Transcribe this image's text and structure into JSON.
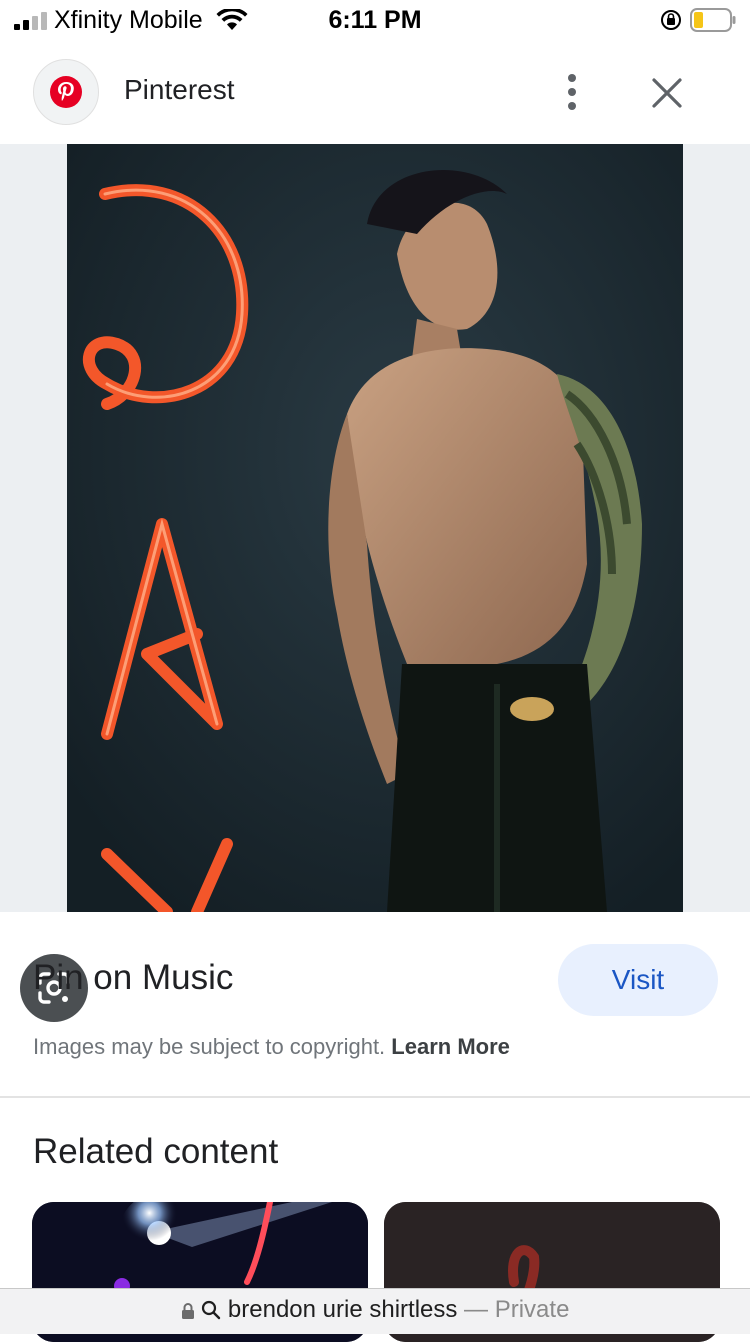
{
  "status_bar": {
    "carrier": "Xfinity Mobile",
    "time": "6:11 PM"
  },
  "header": {
    "source_name": "Pinterest",
    "logo_icon": "pinterest-logo-icon",
    "menu_icon": "more-vertical-icon",
    "close_icon": "close-icon"
  },
  "image": {
    "description_icon": "photo",
    "lens_icon": "google-lens-icon"
  },
  "info": {
    "title": "Pin on Music",
    "visit_label": "Visit",
    "copyright_text": "Images may be subject to copyright.",
    "learn_more_label": "Learn More"
  },
  "related": {
    "title": "Related content"
  },
  "url_bar": {
    "query": "brendon urie shirtless",
    "separator": "—",
    "mode": "Private"
  },
  "colors": {
    "accent": "#1a56c4",
    "visit_bg": "#e8f0fe",
    "pinterest_red": "#e60023"
  }
}
